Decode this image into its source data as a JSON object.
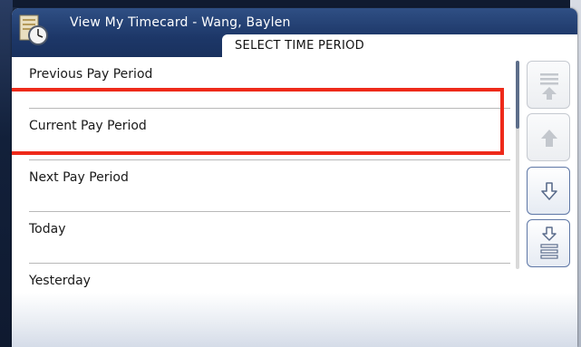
{
  "window": {
    "title": "View My Timecard - Wang, Baylen",
    "app_icon": "timecard-clock-icon"
  },
  "subheader": {
    "label": "SELECT TIME PERIOD"
  },
  "periods": [
    {
      "label": "Previous Pay Period"
    },
    {
      "label": "Current Pay Period",
      "highlighted": true
    },
    {
      "label": "Next Pay Period"
    },
    {
      "label": "Today"
    },
    {
      "label": "Yesterday"
    }
  ],
  "navigation": {
    "buttons": [
      {
        "icon": "scroll-to-top-icon",
        "enabled": false
      },
      {
        "icon": "scroll-up-icon",
        "enabled": false
      },
      {
        "icon": "scroll-down-icon",
        "enabled": true
      },
      {
        "icon": "scroll-to-bottom-icon",
        "enabled": true
      }
    ]
  },
  "colors": {
    "title_bar": "#1d3768",
    "highlight": "#ee2a1a",
    "icon_disabled": "#c3c7cd",
    "icon_enabled": "#5a6c8c"
  }
}
